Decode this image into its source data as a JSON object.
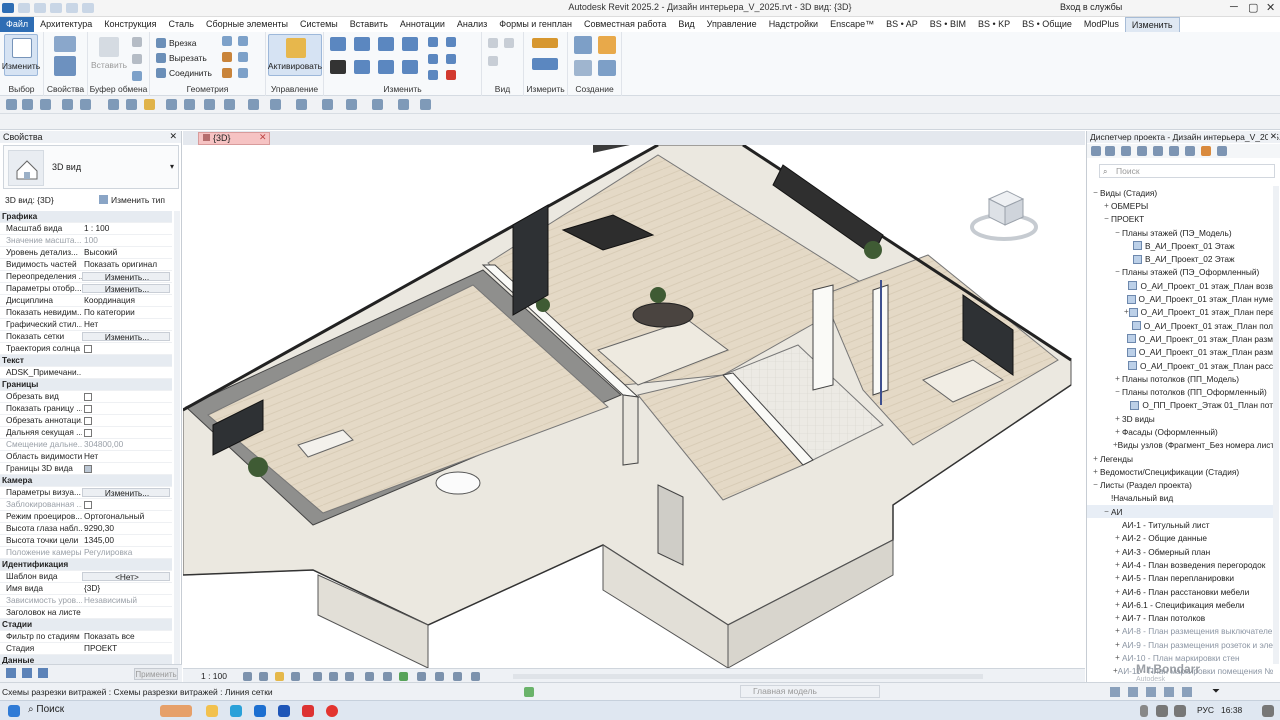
{
  "titlebar": {
    "title": "Autodesk Revit 2025.2 - Дизайн интерьера_V_2025.rvt - 3D вид: {3D}",
    "login": "Вход в службы"
  },
  "menu": {
    "tabs": [
      "Файл",
      "Архитектура",
      "Конструкция",
      "Сталь",
      "Сборные элементы",
      "Системы",
      "Вставить",
      "Аннотации",
      "Анализ",
      "Формы и генплан",
      "Совместная работа",
      "Вид",
      "Управление",
      "Надстройки",
      "Enscape™",
      "BS • AP",
      "BS • BIM",
      "BS • KP",
      "BS • Общие",
      "ModPlus",
      "Изменить"
    ],
    "active": "Изменить"
  },
  "ribbon": {
    "modify_label": "Изменить",
    "select_label": "Выбор",
    "properties_label": "Свойства",
    "clipboard_label": "Буфер обмена",
    "paste_label": "Вставить",
    "geometry_label": "Геометрия",
    "cut_label": "Врезка",
    "cut2_label": "Вырезать",
    "join_label": "Соединить",
    "manage_label": "Управление",
    "activate_label": "Активировать",
    "modify2_label": "Изменить",
    "view_label": "Вид",
    "measure_label": "Измерить",
    "create_label": "Создание"
  },
  "properties": {
    "panel_title": "Свойства",
    "type_name": "3D вид",
    "selector": "3D вид: {3D}",
    "edit_type": "Изменить тип",
    "rows": [
      {
        "k": "Графика",
        "v": "",
        "sec": true
      },
      {
        "k": "Масштаб вида",
        "v": "1 : 100"
      },
      {
        "k": "Значение масшта...",
        "v": "100",
        "dis": true
      },
      {
        "k": "Уровень детализ...",
        "v": "Высокий"
      },
      {
        "k": "Видимость частей",
        "v": "Показать оригинал"
      },
      {
        "k": "Переопределения ...",
        "v": "Изменить...",
        "btn": true
      },
      {
        "k": "Параметры отобр...",
        "v": "Изменить...",
        "btn": true
      },
      {
        "k": "Дисциплина",
        "v": "Координация"
      },
      {
        "k": "Показать невидим...",
        "v": "По категории"
      },
      {
        "k": "Графический стил...",
        "v": "Нет"
      },
      {
        "k": "Показать сетки",
        "v": "Изменить...",
        "btn": true
      },
      {
        "k": "Траектория солнца",
        "v": "",
        "chk": false
      },
      {
        "k": "Текст",
        "v": "",
        "sec": true
      },
      {
        "k": "ADSK_Примечани...",
        "v": ""
      },
      {
        "k": "Границы",
        "v": "",
        "sec": true
      },
      {
        "k": "Обрезать вид",
        "v": "",
        "chk": false
      },
      {
        "k": "Показать границу ...",
        "v": "",
        "chk": false
      },
      {
        "k": "Обрезать аннотаци...",
        "v": "",
        "chk": false
      },
      {
        "k": "Дальняя секущая ...",
        "v": "",
        "chk": false
      },
      {
        "k": "Смещение дальне...",
        "v": "304800,00",
        "dis": true
      },
      {
        "k": "Область видимости",
        "v": "Нет"
      },
      {
        "k": "Границы 3D вида",
        "v": "",
        "chk": true
      },
      {
        "k": "Камера",
        "v": "",
        "sec": true
      },
      {
        "k": "Параметры визуа...",
        "v": "Изменить...",
        "btn": true
      },
      {
        "k": "Заблокированная ...",
        "v": "",
        "chk": false,
        "dis": true
      },
      {
        "k": "Режим проециров...",
        "v": "Ортогональный"
      },
      {
        "k": "Высота глаза набл...",
        "v": "9290,30"
      },
      {
        "k": "Высота точки цели",
        "v": "1345,00"
      },
      {
        "k": "Положение камеры",
        "v": "Регулировка",
        "dis": true
      },
      {
        "k": "Идентификация",
        "v": "",
        "sec": true
      },
      {
        "k": "Шаблон вида",
        "v": "<Нет>",
        "btn": true
      },
      {
        "k": "Имя вида",
        "v": "{3D}"
      },
      {
        "k": "Зависимость уров...",
        "v": "Независимый",
        "dis": true
      },
      {
        "k": "Заголовок на листе",
        "v": ""
      },
      {
        "k": "Стадии",
        "v": "",
        "sec": true
      },
      {
        "k": "Фильтр по стадиям",
        "v": "Показать все"
      },
      {
        "k": "Стадия",
        "v": "ПРОЕКТ"
      },
      {
        "k": "Данные",
        "v": "",
        "sec": true
      }
    ],
    "apply": "Применить"
  },
  "view": {
    "tab_label": "{3D}",
    "scale": "1 : 100"
  },
  "browser": {
    "title": "Диспетчер проекта - Дизайн интерьера_V_2025...",
    "search_placeholder": "Поиск",
    "tree": [
      {
        "t": "Виды (Стадия)",
        "l": 0,
        "tg": "−"
      },
      {
        "t": "ОБМЕРЫ",
        "l": 1,
        "tg": "+"
      },
      {
        "t": "ПРОЕКТ",
        "l": 1,
        "tg": "−"
      },
      {
        "t": "Планы этажей (ПЭ_Модель)",
        "l": 2,
        "tg": "−"
      },
      {
        "t": "В_АИ_Проект_01 Этаж",
        "l": 3,
        "tg": "",
        "sq": true
      },
      {
        "t": "В_АИ_Проект_02 Этаж",
        "l": 3,
        "tg": "",
        "sq": true
      },
      {
        "t": "Планы этажей (ПЭ_Оформленный)",
        "l": 2,
        "tg": "−"
      },
      {
        "t": "О_АИ_Проект_01 этаж_План возв",
        "l": 3,
        "tg": "",
        "sq": true
      },
      {
        "t": "О_АИ_Проект_01 этаж_План нуме",
        "l": 3,
        "tg": "",
        "sq": true
      },
      {
        "t": "О_АИ_Проект_01 этаж_План пере",
        "l": 3,
        "tg": "+",
        "sq": true
      },
      {
        "t": "О_АИ_Проект_01 этаж_План пол",
        "l": 3,
        "tg": "",
        "sq": true
      },
      {
        "t": "О_АИ_Проект_01 этаж_План разм",
        "l": 3,
        "tg": "",
        "sq": true
      },
      {
        "t": "О_АИ_Проект_01 этаж_План разм",
        "l": 3,
        "tg": "",
        "sq": true
      },
      {
        "t": "О_АИ_Проект_01 этаж_План расс",
        "l": 3,
        "tg": "",
        "sq": true
      },
      {
        "t": "Планы потолков (ПП_Модель)",
        "l": 2,
        "tg": "+"
      },
      {
        "t": "Планы потолков (ПП_Оформленный)",
        "l": 2,
        "tg": "−"
      },
      {
        "t": "О_ПП_Проект_Этаж 01_План пот",
        "l": 3,
        "tg": "",
        "sq": true
      },
      {
        "t": "3D виды",
        "l": 2,
        "tg": "+"
      },
      {
        "t": "Фасады (Оформленный)",
        "l": 2,
        "tg": "+"
      },
      {
        "t": "Виды узлов (Фрагмент_Без номера лист",
        "l": 2,
        "tg": "+"
      },
      {
        "t": "Легенды",
        "l": 0,
        "tg": "+"
      },
      {
        "t": "Ведомости/Спецификации (Стадия)",
        "l": 0,
        "tg": "+"
      },
      {
        "t": "Листы (Раздел проекта)",
        "l": 0,
        "tg": "−"
      },
      {
        "t": "!Начальный вид",
        "l": 1,
        "tg": ""
      },
      {
        "t": "АИ",
        "l": 1,
        "tg": "−",
        "hl": true
      },
      {
        "t": "АИ-1 - Титульный лист",
        "l": 2,
        "tg": ""
      },
      {
        "t": "АИ-2 - Общие данные",
        "l": 2,
        "tg": "+"
      },
      {
        "t": "АИ-3 - Обмерный план",
        "l": 2,
        "tg": "+"
      },
      {
        "t": "АИ-4 - План возведения перегородок",
        "l": 2,
        "tg": "+"
      },
      {
        "t": "АИ-5 - План перепланировки",
        "l": 2,
        "tg": "+"
      },
      {
        "t": "АИ-6 - План расстановки мебели",
        "l": 2,
        "tg": "+"
      },
      {
        "t": "АИ-6.1 - Спецификация мебели",
        "l": 2,
        "tg": "+"
      },
      {
        "t": "АИ-7 - План потолков",
        "l": 2,
        "tg": "+"
      },
      {
        "t": "АИ-8 - План размещения выключателе",
        "l": 2,
        "tg": "+",
        "dim": true
      },
      {
        "t": "АИ-9 - План размещения розеток и эле",
        "l": 2,
        "tg": "+",
        "dim": true
      },
      {
        "t": "АИ-10 - План маркировки стен",
        "l": 2,
        "tg": "+",
        "dim": true
      },
      {
        "t": "АИ-11 - План маркировки помещения №1",
        "l": 2,
        "tg": "+",
        "dim": true
      }
    ]
  },
  "status": {
    "message": "Схемы разрезки витражей : Схемы разрезки витражей : Линия сетки",
    "model": "Главная модель"
  },
  "taskbar": {
    "search": "Поиск",
    "lang": "РУС",
    "time": "16:38"
  },
  "watermark": {
    "name": "Mr.Bondarr",
    "sub": "Autodesk"
  }
}
